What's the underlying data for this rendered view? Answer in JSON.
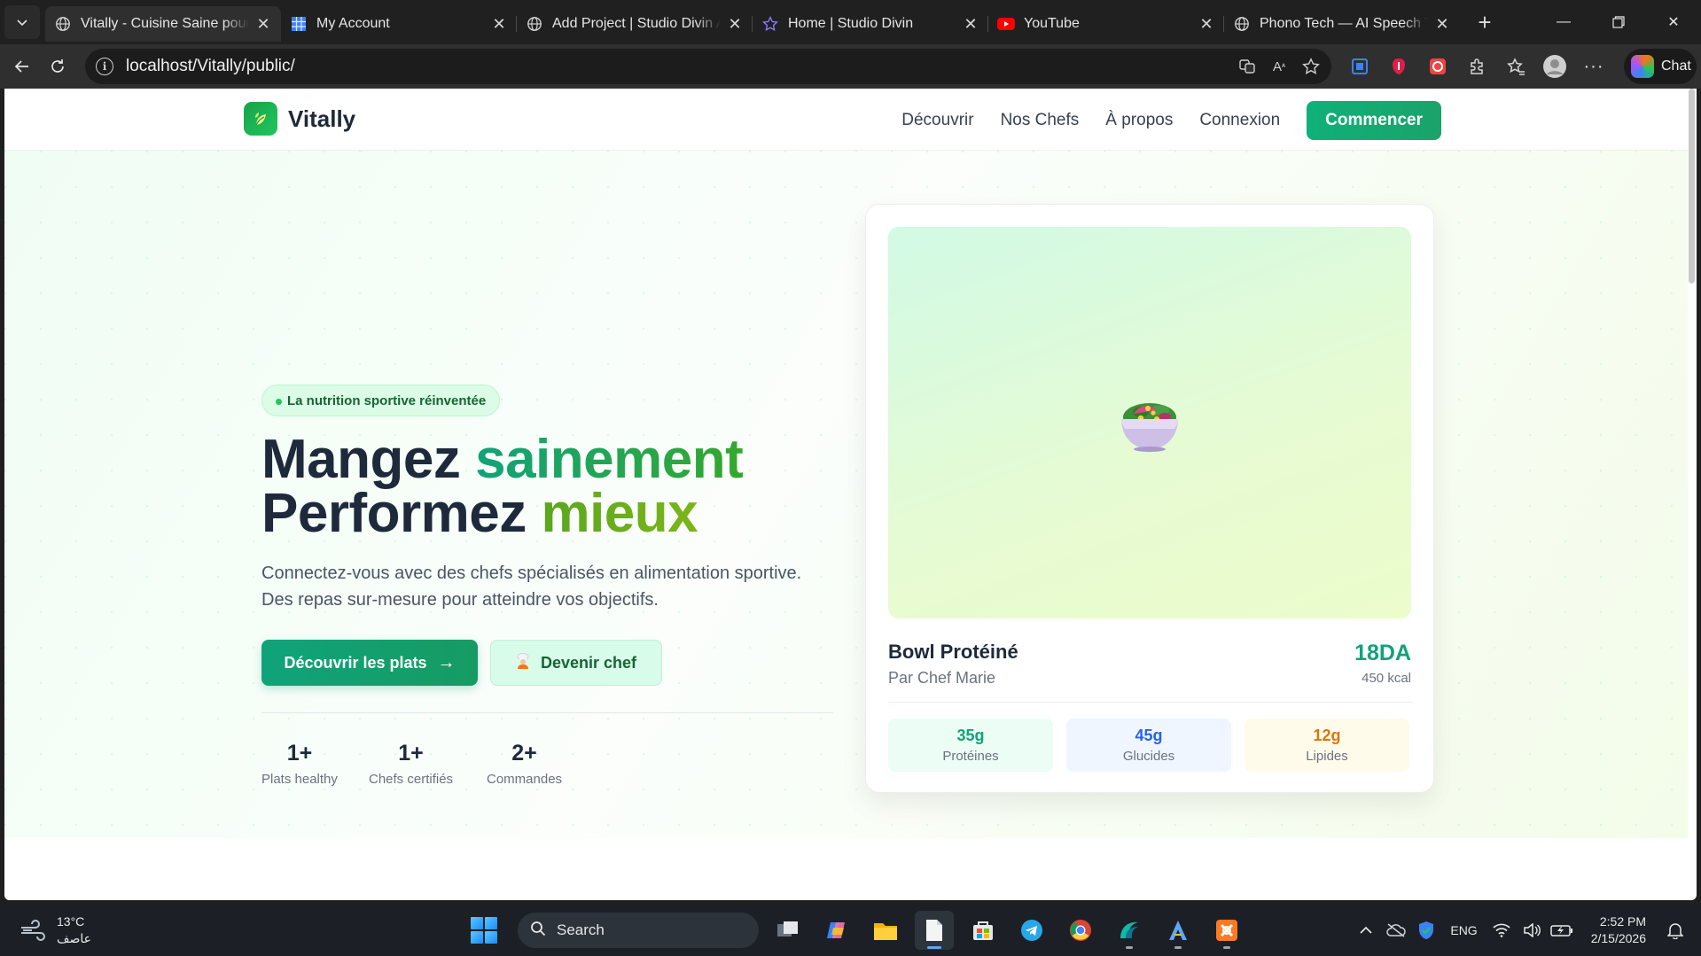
{
  "browser": {
    "tabs": [
      {
        "title": "Vitally - Cuisine Saine pour Sportifs",
        "icon": "globe-icon",
        "active": true
      },
      {
        "title": "My Account",
        "icon": "grid-icon",
        "active": false
      },
      {
        "title": "Add Project | Studio Divin Admin",
        "icon": "globe-icon",
        "active": false
      },
      {
        "title": "Home | Studio Divin",
        "icon": "star-icon",
        "active": false
      },
      {
        "title": "YouTube",
        "icon": "youtube-icon",
        "active": false
      },
      {
        "title": "Phono Tech — AI Speech Therapy",
        "icon": "globe-icon",
        "active": false
      }
    ],
    "url": "localhost/Vitally/public/",
    "chat_label": "Chat"
  },
  "site": {
    "brand": "Vitally",
    "nav": {
      "discover": "Découvrir",
      "chefs": "Nos Chefs",
      "about": "À propos",
      "login": "Connexion",
      "cta": "Commencer"
    },
    "hero": {
      "badge": "La nutrition sportive réinventée",
      "title_line1_a": "Mangez ",
      "title_line1_b": "sainement",
      "title_line2_a": "Performez ",
      "title_line2_b": "mieux",
      "lead": "Connectez-vous avec des chefs spécialisés en alimentation sportive. Des repas sur-mesure pour atteindre vos objectifs.",
      "primary_button": "Découvrir les plats",
      "primary_arrow": "→",
      "secondary_button": "Devenir chef",
      "stats": [
        {
          "value": "1+",
          "label": "Plats healthy"
        },
        {
          "value": "1+",
          "label": "Chefs certifiés"
        },
        {
          "value": "2+",
          "label": "Commandes"
        }
      ]
    },
    "card": {
      "dish": "Bowl Protéiné",
      "chef": "Par Chef Marie",
      "price": "18DA",
      "kcal": "450 kcal",
      "macros": [
        {
          "value": "35g",
          "label": "Protéines",
          "color": "#10a37a",
          "bg": "#ecfdf5"
        },
        {
          "value": "45g",
          "label": "Glucides",
          "color": "#2563eb",
          "bg": "#eff6ff"
        },
        {
          "value": "12g",
          "label": "Lipides",
          "color": "#d97706",
          "bg": "#fffbeb"
        }
      ]
    },
    "colors": {
      "accent": "#10a37a",
      "secondary_accent": "#65a30d"
    }
  },
  "taskbar": {
    "weather_temp": "13°C",
    "weather_desc": "عاصف",
    "search_placeholder": "Search",
    "language": "ENG",
    "time": "2:52 PM",
    "date": "2/15/2026"
  }
}
